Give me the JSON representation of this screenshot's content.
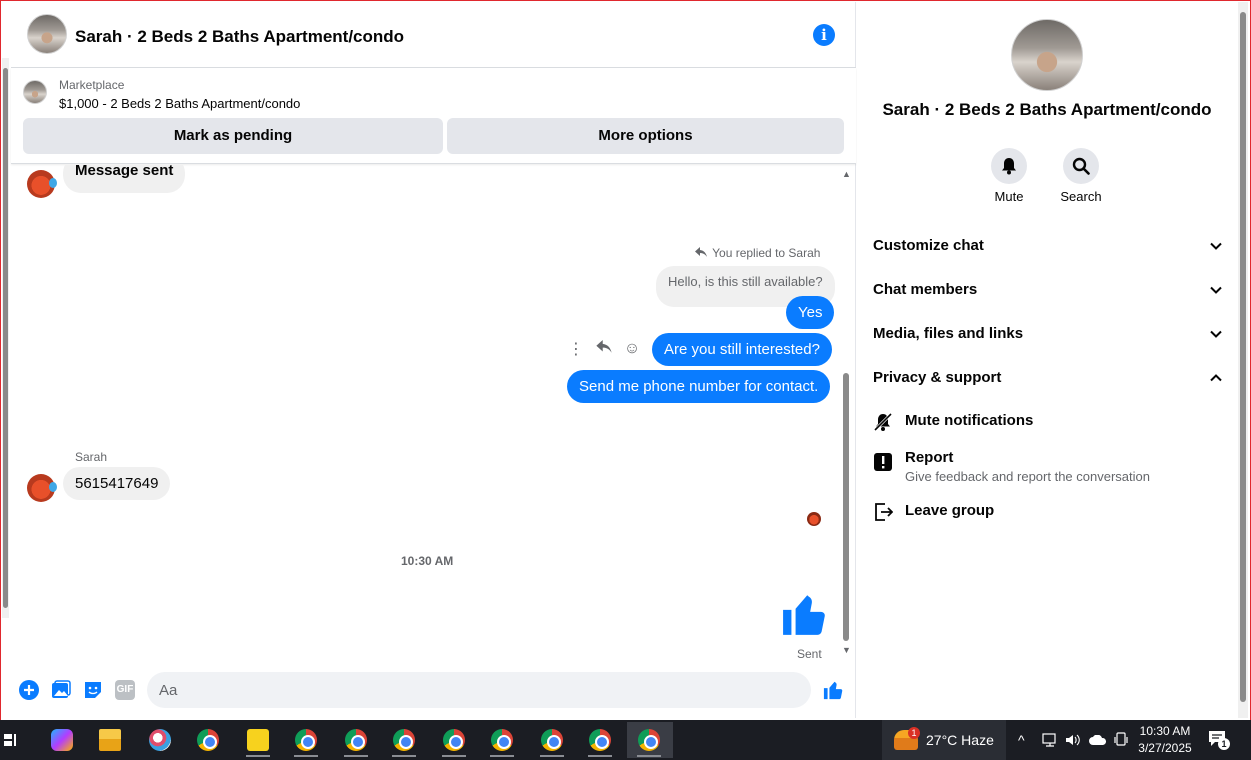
{
  "chat": {
    "title": "Sarah · 2 Beds 2 Baths Apartment/condo",
    "marketplace_label": "Marketplace",
    "listing_price_title": "$1,000 - 2 Beds 2 Baths Apartment/condo",
    "mark_pending_label": "Mark as pending",
    "more_options_label": "More options"
  },
  "messages": {
    "first_incoming": "Message sent",
    "reply_note": "You replied to Sarah",
    "quoted_text": "Hello, is this still available?",
    "out_yes": "Yes",
    "out_interested": "Are you still interested?",
    "out_phone": "Send me phone number for contact.",
    "sender_name": "Sarah",
    "incoming_phone": "5615417649",
    "timestamp": "10:30 AM",
    "sent_status": "Sent"
  },
  "composer": {
    "placeholder": "Aa",
    "gif_label": "GIF"
  },
  "panel": {
    "title": "Sarah · 2 Beds 2 Baths Apartment/condo",
    "mute_label": "Mute",
    "search_label": "Search",
    "sections": {
      "customize": "Customize chat",
      "members": "Chat members",
      "media": "Media, files and links",
      "privacy": "Privacy & support"
    },
    "options": {
      "mute_notifications": "Mute notifications",
      "report": "Report",
      "report_sub": "Give feedback and report the conversation",
      "leave_group": "Leave group"
    }
  },
  "taskbar": {
    "weather": "27°C  Haze",
    "weather_badge": "1",
    "time": "10:30 AM",
    "date": "3/27/2025",
    "notification_count": "1"
  },
  "colors": {
    "messenger_blue": "#0a7cff",
    "bubble_gray": "#f0f0f0",
    "button_gray": "#e4e6eb"
  }
}
